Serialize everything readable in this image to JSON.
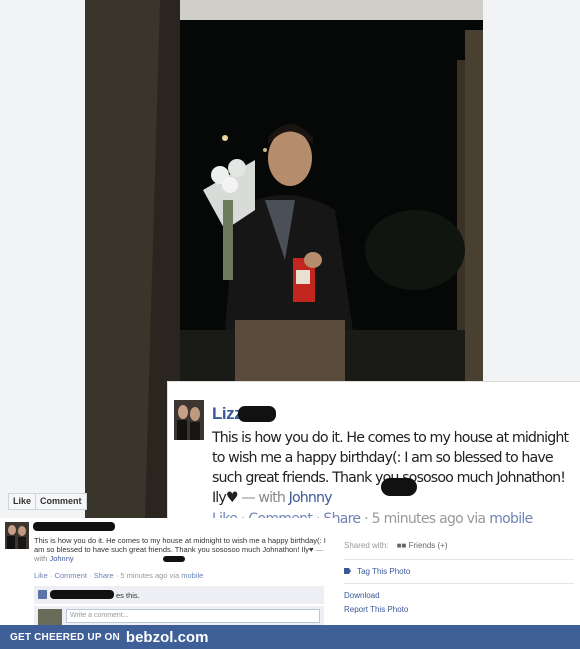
{
  "photo_actions": {
    "like": "Like",
    "comment": "Comment"
  },
  "zoom_caption": {
    "author": "Lizz",
    "text": "This is how you do it. He comes to my house at midnight to wish me a happy birthday(: I am so blessed to have such great friends. Thank you sososoo much Johnathon! Ily♥",
    "with_label": "— with",
    "tagged": "Johnny",
    "like": "Like",
    "comment": "Comment",
    "share": "Share",
    "separator": "·",
    "time": "5 minutes ago via",
    "via": "mobile"
  },
  "post": {
    "text": "This is how you do it. He comes to my house at midnight to wish me a happy birthday(: I am so blessed to have such great friends. Thank you sososoo much Johnathon! Ily♥",
    "with_label": "— with",
    "tagged": "Johnny",
    "like": "Like",
    "comment": "Comment",
    "share": "Share",
    "separator": "·",
    "time": "5 minutes ago via",
    "via": "mobile",
    "likes_suffix": "es this.",
    "comment_placeholder": "Write a comment..."
  },
  "sidebar": {
    "shared_with": "Shared with:",
    "audience": "Friends (+)",
    "tag_photo": "Tag This Photo",
    "download": "Download",
    "report": "Report This Photo"
  },
  "footer": {
    "tagline": "GET CHEERED UP ON",
    "brand": "bebzol.com"
  }
}
